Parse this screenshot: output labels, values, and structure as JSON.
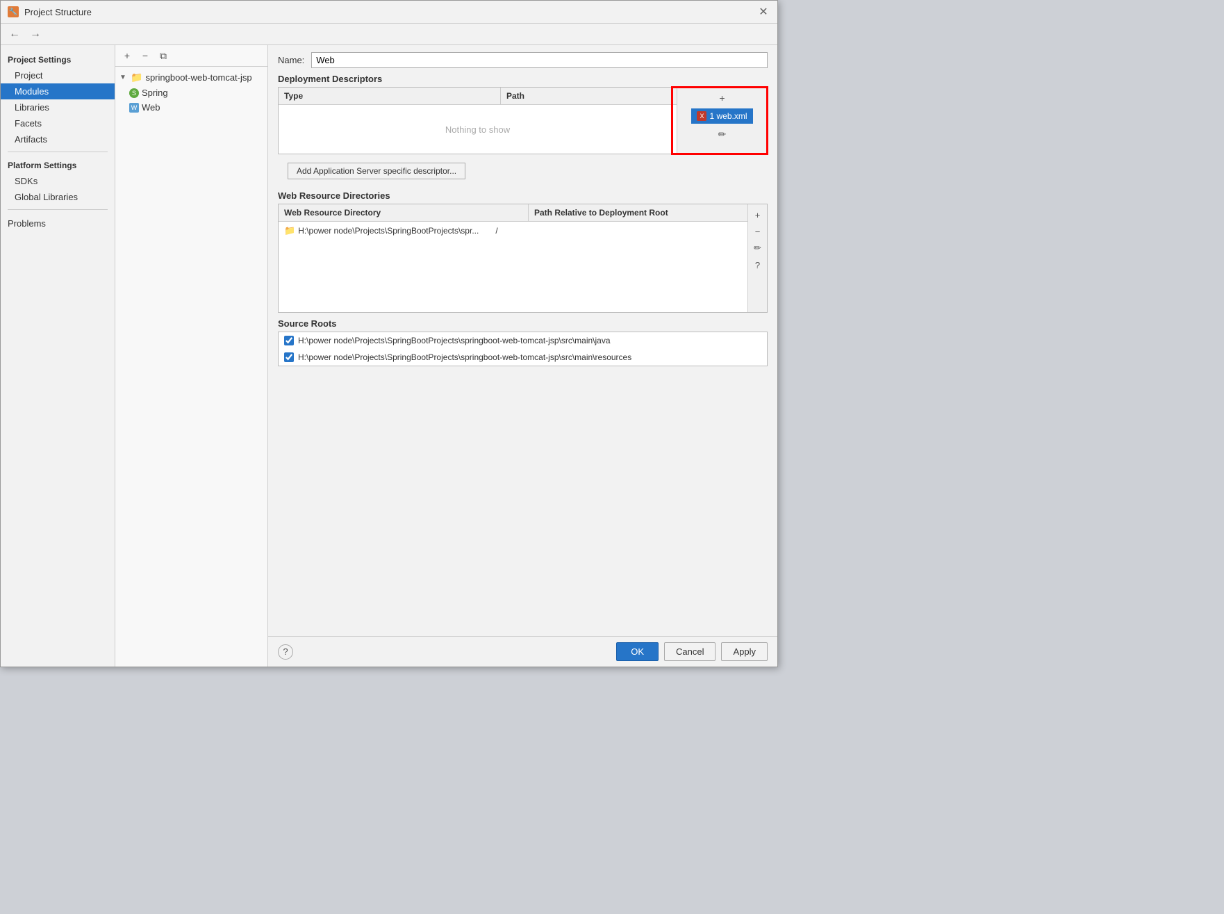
{
  "dialog": {
    "title": "Project Structure",
    "close_label": "✕"
  },
  "nav": {
    "back_label": "←",
    "forward_label": "→"
  },
  "sidebar": {
    "project_settings_header": "Project Settings",
    "project_label": "Project",
    "modules_label": "Modules",
    "libraries_label": "Libraries",
    "facets_label": "Facets",
    "artifacts_label": "Artifacts",
    "platform_settings_header": "Platform Settings",
    "sdks_label": "SDKs",
    "global_libraries_label": "Global Libraries",
    "problems_label": "Problems"
  },
  "tree": {
    "add_label": "+",
    "remove_label": "−",
    "copy_label": "⧉",
    "root_label": "springboot-web-tomcat-jsp",
    "spring_label": "Spring",
    "web_label": "Web"
  },
  "content": {
    "name_label": "Name:",
    "name_value": "Web",
    "deployment_descriptors_title": "Deployment Descriptors",
    "type_col": "Type",
    "path_col": "Path",
    "nothing_to_show": "Nothing to show",
    "add_icon": "+",
    "edit_icon": "✏",
    "add_app_server_btn": "Add Application Server specific descriptor...",
    "web_resource_title": "Web Resource Directories",
    "wr_col1": "Web Resource Directory",
    "wr_col2": "Path Relative to Deployment Root",
    "wr_path": "H:\\power node\\Projects\\SpringBootProjects\\spr...",
    "wr_slash": "/",
    "source_roots_title": "Source Roots",
    "source_path1": "H:\\power node\\Projects\\SpringBootProjects\\springboot-web-tomcat-jsp\\src\\main\\java",
    "source_path2": "H:\\power node\\Projects\\SpringBootProjects\\springboot-web-tomcat-jsp\\src\\main\\resources",
    "descriptor_item_label": "1  web.xml"
  },
  "footer": {
    "help_label": "?",
    "ok_label": "OK",
    "cancel_label": "Cancel",
    "apply_label": "Apply"
  }
}
